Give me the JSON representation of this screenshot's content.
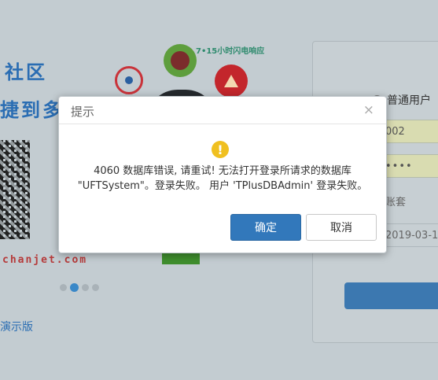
{
  "background": {
    "heading_line1": "社区",
    "heading_line2": "捷到多",
    "promo_text": "7•15小时闪电响应",
    "website": "chanjet.com",
    "demo_link": "演示版",
    "login": {
      "user_type_label": "普通用户",
      "username_value": "002",
      "password_value": "••••",
      "account_label": "账套",
      "date_value": "2019-03-1"
    },
    "carousel_dots": 4,
    "carousel_active_index": 1
  },
  "dialog": {
    "title": "提示",
    "close_symbol": "×",
    "warning_symbol": "!",
    "message_line1": "4060 数据库错误, 请重试! 无法打开登录所请求的数据库",
    "message_line2": "\"UFTSystem\"。登录失败。 用户 'TPlusDBAdmin' 登录失败。",
    "ok_label": "确定",
    "cancel_label": "取消"
  },
  "colors": {
    "accent_blue": "#3278bb",
    "warning_yellow": "#f0c020",
    "overlay_bg": "#c3ccd1"
  }
}
